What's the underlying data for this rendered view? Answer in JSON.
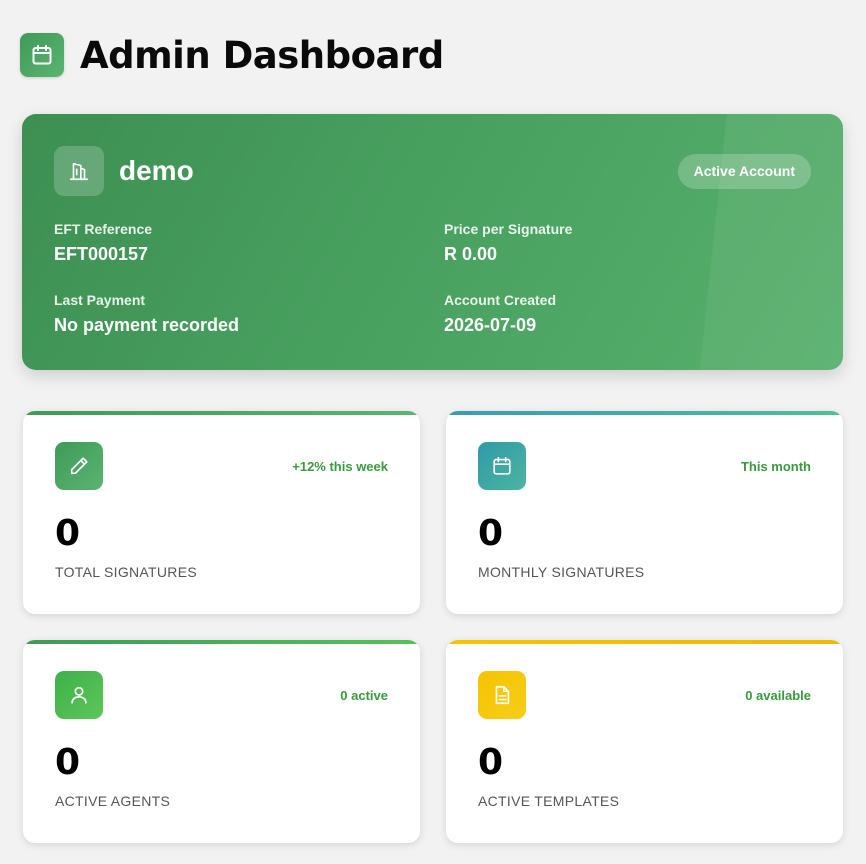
{
  "header": {
    "title": "Admin Dashboard",
    "icon": "calendar-icon"
  },
  "account": {
    "name": "demo",
    "status": "Active Account",
    "icon": "building-icon",
    "fields": {
      "eft_reference_label": "EFT Reference",
      "eft_reference_value": "EFT000157",
      "price_label": "Price per Signature",
      "price_value": "R 0.00",
      "last_payment_label": "Last Payment",
      "last_payment_value": "No payment recorded",
      "created_label": "Account Created",
      "created_value": "2026-07-09"
    }
  },
  "stats": [
    {
      "value": "0",
      "label": "TOTAL SIGNATURES",
      "tag": "+12% this week",
      "icon": "pen-icon",
      "color": "#45a05c"
    },
    {
      "value": "0",
      "label": "MONTHLY SIGNATURES",
      "tag": "This month",
      "icon": "calendar-icon",
      "color": "#3aa8a0"
    },
    {
      "value": "0",
      "label": "ACTIVE AGENTS",
      "tag": "0 active",
      "icon": "user-icon",
      "color": "#4cbb4f"
    },
    {
      "value": "0",
      "label": "ACTIVE TEMPLATES",
      "tag": "0 available",
      "icon": "document-icon",
      "color": "#f5c400"
    }
  ],
  "colors": {
    "accent_green": "#48a05f",
    "tag_green": "#3a9a3e"
  }
}
